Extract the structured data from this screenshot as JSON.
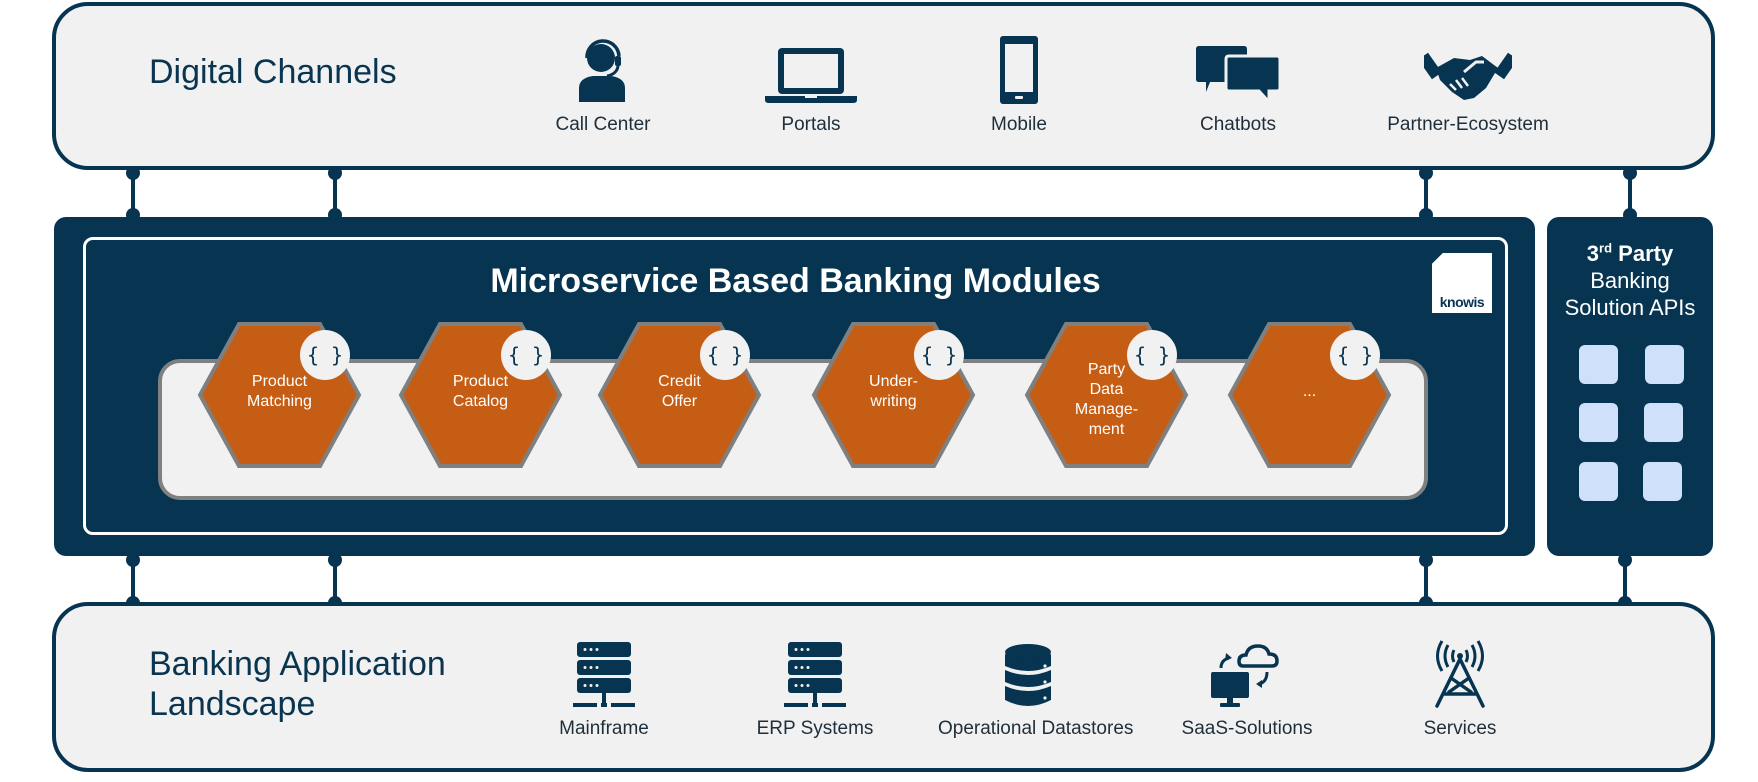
{
  "digital_channels": {
    "title": "Digital Channels",
    "items": [
      {
        "label": "Call Center",
        "icon": "headset-agent-icon"
      },
      {
        "label": "Portals",
        "icon": "laptop-icon"
      },
      {
        "label": "Mobile",
        "icon": "smartphone-icon"
      },
      {
        "label": "Chatbots",
        "icon": "chat-bubbles-icon"
      },
      {
        "label": "Partner-Ecosystem",
        "icon": "handshake-icon"
      }
    ]
  },
  "modules": {
    "title": "Microservice Based Banking Modules",
    "logo_text": "knowis",
    "api_badge": "{ }",
    "items": [
      {
        "label": "Product Matching",
        "lines": [
          "Product",
          "Matching"
        ]
      },
      {
        "label": "Product Catalog",
        "lines": [
          "Product",
          "Catalog"
        ]
      },
      {
        "label": "Credit Offer",
        "lines": [
          "Credit",
          "Offer"
        ]
      },
      {
        "label": "Underwriting",
        "lines": [
          "Under-",
          "writing"
        ]
      },
      {
        "label": "Party Data Management",
        "lines": [
          "Party",
          "Data",
          "Manage-",
          "ment"
        ]
      },
      {
        "label": "...",
        "lines": [
          "..."
        ]
      }
    ]
  },
  "third_party": {
    "prefix": "3",
    "superscript": "rd",
    "bold_word": "Party",
    "line2": "Banking",
    "line3": "Solution APIs",
    "api_tiles": 6
  },
  "landscape": {
    "title_line1": "Banking Application",
    "title_line2": "Landscape",
    "items": [
      {
        "label": "Mainframe",
        "icon": "server-rack-icon"
      },
      {
        "label": "ERP Systems",
        "icon": "server-rack-icon"
      },
      {
        "label": "Operational Datastores",
        "icon": "database-icon"
      },
      {
        "label": "SaaS-Solutions",
        "icon": "cloud-sync-icon"
      },
      {
        "label": "Services",
        "icon": "radio-tower-icon"
      }
    ]
  },
  "colors": {
    "navy": "#063451",
    "orange": "#c55d14",
    "light_gray": "#f1f1f1",
    "lane_border": "#808080",
    "api_tile": "#cfe0fa"
  }
}
